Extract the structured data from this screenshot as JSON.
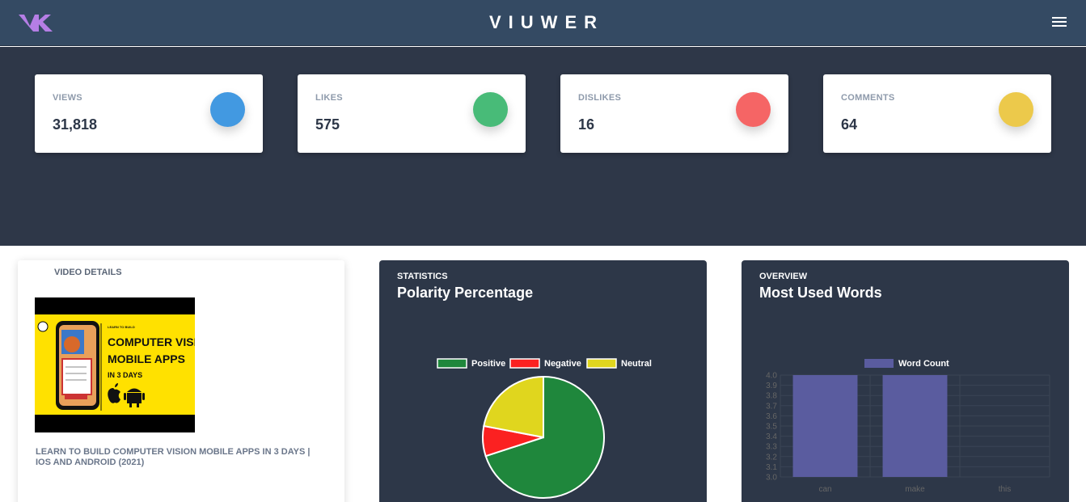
{
  "navbar": {
    "brand": "VIUWER",
    "logo_icon": "vk-logo-icon",
    "menu_icon": "hamburger-menu-icon",
    "colors": {
      "background": "#344a63",
      "logo": "#b57ee5"
    }
  },
  "stats": [
    {
      "label": "VIEWS",
      "value": "31,818",
      "color": "#4299e1"
    },
    {
      "label": "LIKES",
      "value": "575",
      "color": "#48bb78"
    },
    {
      "label": "DISLIKES",
      "value": "16",
      "color": "#f56565"
    },
    {
      "label": "COMMENTS",
      "value": "64",
      "color": "#ecc94b"
    }
  ],
  "video_details": {
    "title": "VIDEO DETAILS",
    "thumbnail": {
      "badge": "LEARN TO BUILD",
      "line1": "COMPUTER VISION",
      "line2": "MOBILE APPS",
      "line3": "IN 3 DAYS",
      "icons": [
        "apple-icon",
        "android-icon"
      ]
    },
    "video_title": "LEARN TO BUILD COMPUTER VISION MOBILE APPS IN 3 DAYS | IOS AND ANDROID (2021)"
  },
  "statistics_card": {
    "kicker": "STATISTICS",
    "heading": "Polarity Percentage"
  },
  "overview_card": {
    "kicker": "OVERVIEW",
    "heading": "Most Used Words"
  },
  "chart_data": [
    {
      "type": "pie",
      "title": "Polarity Percentage",
      "categories": [
        "Positive",
        "Negative",
        "Neutral"
      ],
      "values": [
        70,
        8,
        22
      ],
      "colors": [
        "#1f873c",
        "#fb2121",
        "#e0d61e"
      ],
      "legend": "top"
    },
    {
      "type": "bar",
      "title": "Most Used Words",
      "categories": [
        "can",
        "make",
        "this"
      ],
      "series": [
        {
          "name": "Word Count",
          "values": [
            4,
            4,
            3
          ]
        }
      ],
      "ylim": [
        3.0,
        4.0
      ],
      "yticks": [
        "4.0",
        "3.9",
        "3.8",
        "3.7",
        "3.6",
        "3.5",
        "3.4",
        "3.3",
        "3.2",
        "3.1",
        "3.0"
      ],
      "grid": true,
      "legend": "top",
      "color": "#5a5c9f"
    }
  ]
}
